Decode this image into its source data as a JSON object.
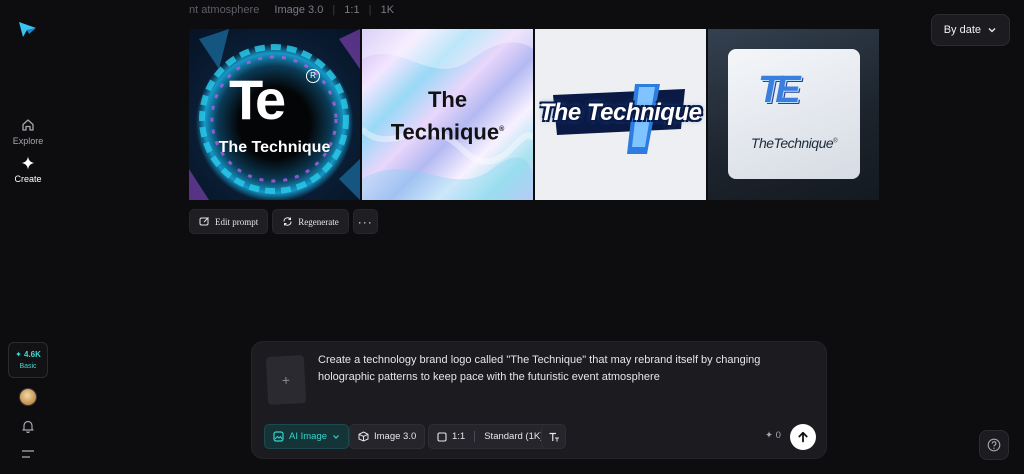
{
  "sidebar": {
    "items": [
      {
        "label": "Explore",
        "icon": "home-icon"
      },
      {
        "label": "Create",
        "icon": "sparkle-icon"
      }
    ],
    "credits": {
      "count": "✦ 4.6K",
      "plan": "Basic"
    }
  },
  "header": {
    "prompt_snippet": "nt atmosphere",
    "model": "Image 3.0",
    "ratio": "1:1",
    "resolution": "1K",
    "sort_label": "By date"
  },
  "images": [
    {
      "alt": "icon-style dark holographic logo",
      "monogram": "Te",
      "reg": "R",
      "caption": "The Technique"
    },
    {
      "alt": "holographic background logo",
      "line1": "The",
      "line2": "Technique",
      "reg": "®"
    },
    {
      "alt": "sticker style logo",
      "caption": "The Technique"
    },
    {
      "alt": "card style logo",
      "monogram": "TE",
      "caption": "TheTechnique",
      "reg": "®"
    }
  ],
  "actions": {
    "edit": "Edit prompt",
    "regenerate": "Regenerate",
    "more": "···"
  },
  "prompt": {
    "text": "Create a technology brand logo called \"The Technique\" that may rebrand itself by changing holographic patterns to keep pace with the futuristic event atmosphere",
    "mode": "AI Image",
    "model": "Image 3.0",
    "ratio": "1:1",
    "quality": "Standard (1K)",
    "cost": "✦ 0"
  },
  "colors": {
    "accent": "#3ad3cb",
    "background": "#0d0d0f",
    "panel": "#1b1b20"
  }
}
